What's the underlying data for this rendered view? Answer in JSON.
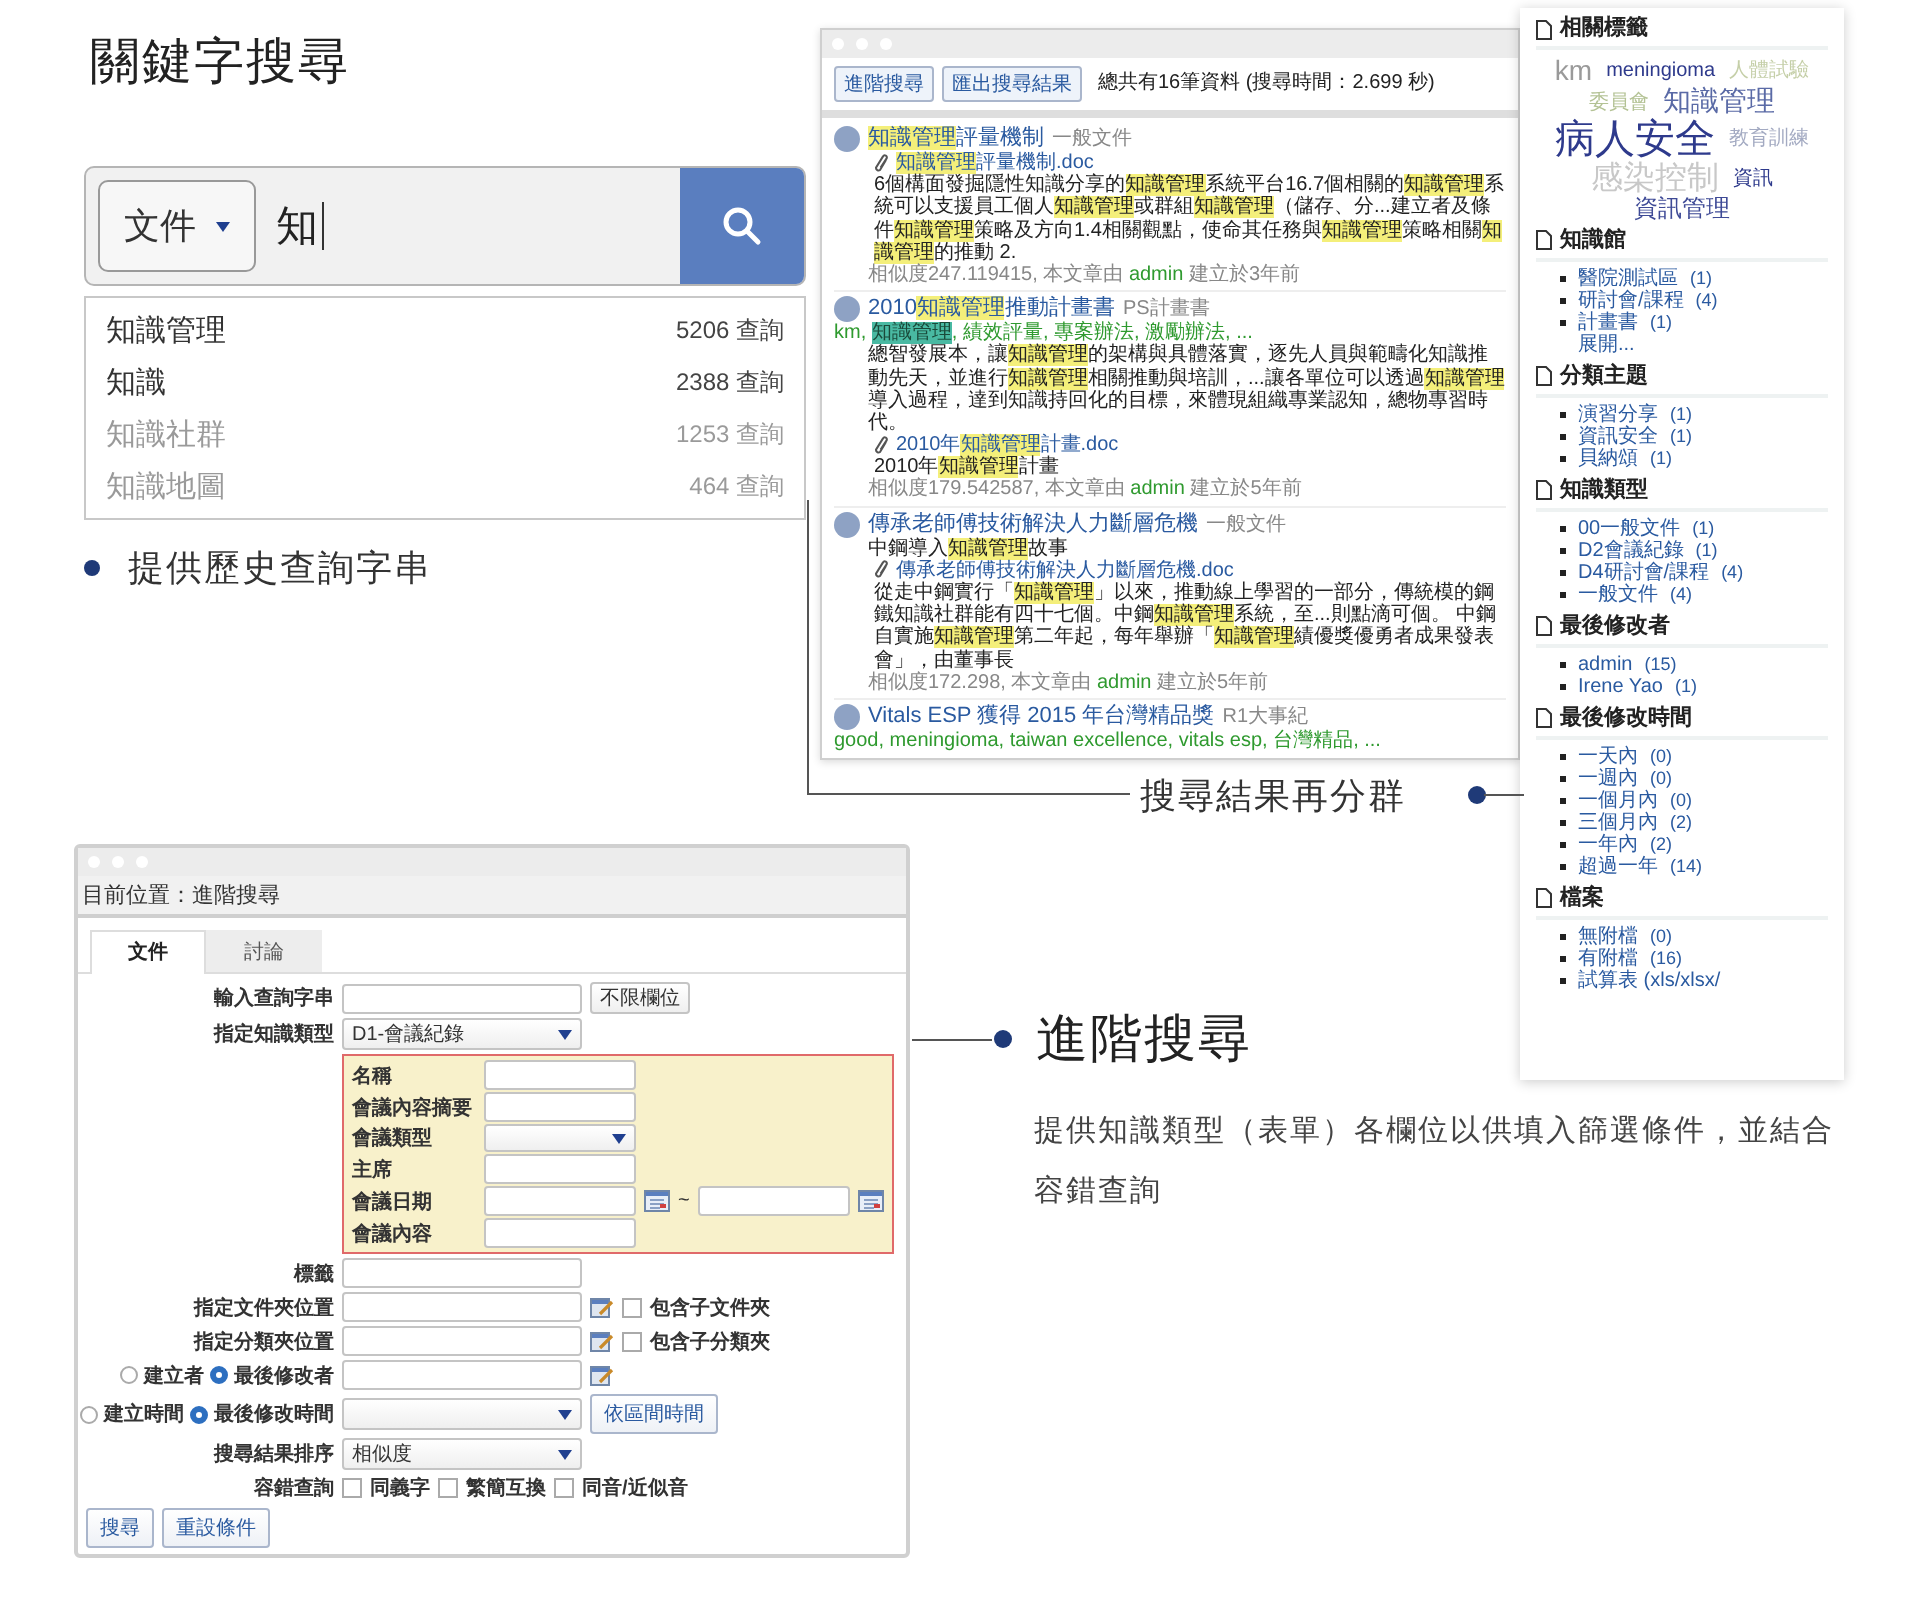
{
  "heading": "關鍵字搜尋",
  "search": {
    "scope": "文件",
    "value": "知"
  },
  "suggestions": [
    {
      "term": "知識管理",
      "count": "5206 查詢",
      "dimmed": false
    },
    {
      "term": "知識",
      "count": "2388 查詢",
      "dimmed": false
    },
    {
      "term": "知識社群",
      "count": "1253 查詢",
      "dimmed": true
    },
    {
      "term": "知識地圖",
      "count": "464 查詢",
      "dimmed": true
    }
  ],
  "history_note": "提供歷史查詢字串",
  "results_window": {
    "buttons": [
      "進階搜尋",
      "匯出搜尋結果"
    ],
    "summary": "總共有16筆資料 (搜尋時間：2.699 秒)",
    "results": [
      {
        "title": "**知識管理**評量機制",
        "type": "一般文件",
        "blocks": [
          {
            "kind": "attachment",
            "text": "**知識管理**評量機制.doc"
          },
          {
            "kind": "attachment_text",
            "text": "6個構面發掘隱性知識分享的**知識管理**系統平台16.7個相關的**知識管理**系統可以支援員工個人**知識管理**或群組**知識管理**（儲存、分...建立者及條件**知識管理**策略及方向1.4相關觀點，使命其任務與**知識管理**策略相關**知識管理**的推動 2."
          }
        ],
        "meta_before": "相似度247.119415, 本文章由",
        "author": "admin",
        "meta_after": "建立於3年前"
      },
      {
        "title": "2010**知識管理**推動計畫書",
        "type": "PS計畫書",
        "tags": "km, **知識管理**, 績效評量, 專案辦法, 激勵辦法, ...",
        "blocks": [
          {
            "kind": "text",
            "text": "總智發展本，讓**知識管理**的架構與具體落實，逐先人員與範疇化知識推動先天，並進行**知識管理**相關推動與培訓，...讓各單位可以透過**知識管理**導入過程，達到知識持回化的目標，來體現組織專業認知，總物專習時代。"
          },
          {
            "kind": "attachment",
            "text": "2010年**知識管理**計畫.doc"
          },
          {
            "kind": "attachment_text",
            "text": "2010年**知識管理**計畫"
          }
        ],
        "meta_before": "相似度179.542587, 本文章由",
        "author": "admin",
        "meta_after": "建立於5年前"
      },
      {
        "title": "傳承老師傅技術解決人力斷層危機",
        "type": "一般文件",
        "blocks": [
          {
            "kind": "text",
            "text": "中鋼導入**知識管理**故事"
          },
          {
            "kind": "attachment",
            "text": "傳承老師傅技術解決人力斷層危機.doc"
          },
          {
            "kind": "attachment_text",
            "text": "從走中鋼實行「**知識管理**」以來，推動線上學習的一部分，傳統模的鋼鐵知識社群能有四十七個。中鋼**知識管理**系統，至...則點滴可個。 中鋼自實施**知識管理**第二年起，每年舉辦「**知識管理**績優獎優勇者成果發表會」，由董事長"
          }
        ],
        "meta_before": "相似度172.298, 本文章由",
        "author": "admin",
        "meta_after": "建立於5年前"
      },
      {
        "title": "Vitals ESP 獲得 2015 年台灣精品獎",
        "type": "R1大事紀",
        "tags": "good, meningioma, taiwan excellence, vitals esp, 台灣精品, ..."
      }
    ]
  },
  "cluster_note": "搜尋結果再分群",
  "sidebar": {
    "sections": [
      {
        "title": "相關標籤",
        "kind": "cloud",
        "tags": [
          {
            "text": "km",
            "kind": "medium",
            "color": "#9a9a9a"
          },
          {
            "text": "meningioma",
            "kind": "tiny",
            "color": "#2e3a8c"
          },
          {
            "text": "人體試驗",
            "kind": "tiny",
            "color": "#c5cfa8"
          },
          {
            "text": "委員會",
            "kind": "tiny",
            "color": "#b3c294"
          },
          {
            "text": "知識管理",
            "kind": "medium",
            "color": "#5a6aa6"
          },
          {
            "text": "病人安全",
            "kind": "huge",
            "color": "#2e3a8c"
          },
          {
            "text": "教育訓練",
            "kind": "tiny",
            "color": "#a3aac2"
          },
          {
            "text": "感染控制",
            "kind": "large",
            "color": "#c8c8c8"
          },
          {
            "text": "資訊",
            "kind": "tiny",
            "color": "#2e3a8c"
          },
          {
            "text": "資訊管理",
            "kind": "small",
            "color": "#3e4a96"
          }
        ]
      },
      {
        "title": "知識館",
        "kind": "list",
        "items": [
          {
            "label": "醫院測試區",
            "count": "(1)"
          },
          {
            "label": "研討會/課程",
            "count": "(4)"
          },
          {
            "label": "計畫書",
            "count": "(1)"
          }
        ],
        "more": "展開..."
      },
      {
        "title": "分類主題",
        "kind": "list",
        "items": [
          {
            "label": "演習分享",
            "count": "(1)"
          },
          {
            "label": "資訊安全",
            "count": "(1)"
          },
          {
            "label": "貝納頌",
            "count": "(1)"
          }
        ]
      },
      {
        "title": "知識類型",
        "kind": "list",
        "items": [
          {
            "label": "00一般文件",
            "count": "(1)"
          },
          {
            "label": "D2會議紀錄",
            "count": "(1)"
          },
          {
            "label": "D4研討會/課程",
            "count": "(4)"
          },
          {
            "label": "一般文件",
            "count": "(4)"
          }
        ]
      },
      {
        "title": "最後修改者",
        "kind": "list",
        "items": [
          {
            "label": "admin",
            "count": "(15)"
          },
          {
            "label": "Irene Yao",
            "count": "(1)"
          }
        ]
      },
      {
        "title": "最後修改時間",
        "kind": "list",
        "items": [
          {
            "label": "一天內",
            "count": "(0)"
          },
          {
            "label": "一週內",
            "count": "(0)"
          },
          {
            "label": "一個月內",
            "count": "(0)"
          },
          {
            "label": "三個月內",
            "count": "(2)"
          },
          {
            "label": "一年內",
            "count": "(2)"
          },
          {
            "label": "超過一年",
            "count": "(14)"
          }
        ]
      },
      {
        "title": "檔案",
        "kind": "list",
        "items": [
          {
            "label": "無附檔",
            "count": "(0)"
          },
          {
            "label": "有附檔",
            "count": "(16)"
          },
          {
            "label": "試算表 (xls/xlsx/"
          }
        ]
      }
    ]
  },
  "form_window": {
    "breadcrumb": "目前位置：進階搜尋",
    "tabs": [
      {
        "label": "文件",
        "selected": true
      },
      {
        "label": "討論",
        "selected": false
      }
    ],
    "fields": [
      {
        "kind": "text_select",
        "label": "輸入查詢字串",
        "select": "不限欄位"
      },
      {
        "kind": "select",
        "label": "指定知識類型",
        "value": "D1-會議紀錄"
      },
      {
        "kind": "group",
        "fields": [
          {
            "kind": "text",
            "label": "名稱"
          },
          {
            "kind": "text",
            "label": "會議內容摘要"
          },
          {
            "kind": "select",
            "label": "會議類型"
          },
          {
            "kind": "text",
            "label": "主席"
          },
          {
            "kind": "date_range",
            "label": "會議日期",
            "separator": "~"
          },
          {
            "kind": "text",
            "label": "會議內容"
          }
        ]
      },
      {
        "kind": "text",
        "label": "標籤"
      },
      {
        "kind": "picker",
        "label": "指定文件夾位置",
        "checkbox": {
          "label": "包含子文件夾",
          "checked": false
        }
      },
      {
        "kind": "picker",
        "label": "指定分類夾位置",
        "checkbox": {
          "label": "包含子分類夾",
          "checked": false
        }
      },
      {
        "kind": "radio_picker",
        "options": [
          {
            "label": "建立者",
            "selected": false
          },
          {
            "label": "最後修改者",
            "selected": true
          }
        ]
      },
      {
        "kind": "radio_select",
        "options": [
          {
            "label": "建立時間",
            "selected": false
          },
          {
            "label": "最後修改時間",
            "selected": true
          }
        ],
        "button": "依區間時間"
      },
      {
        "kind": "select",
        "label": "搜尋結果排序",
        "value": "相似度"
      },
      {
        "kind": "checks",
        "label": "容錯查詢",
        "options": [
          {
            "label": "同義字",
            "checked": false
          },
          {
            "label": "繁簡互換",
            "checked": false
          },
          {
            "label": "同音/近似音",
            "checked": false
          }
        ]
      }
    ],
    "buttons": [
      "搜尋",
      "重設條件"
    ]
  },
  "advanced_note": {
    "title": "進階搜尋",
    "description": "提供知識類型（表單）各欄位以供填入篩選條件，並結合容錯查詢"
  }
}
